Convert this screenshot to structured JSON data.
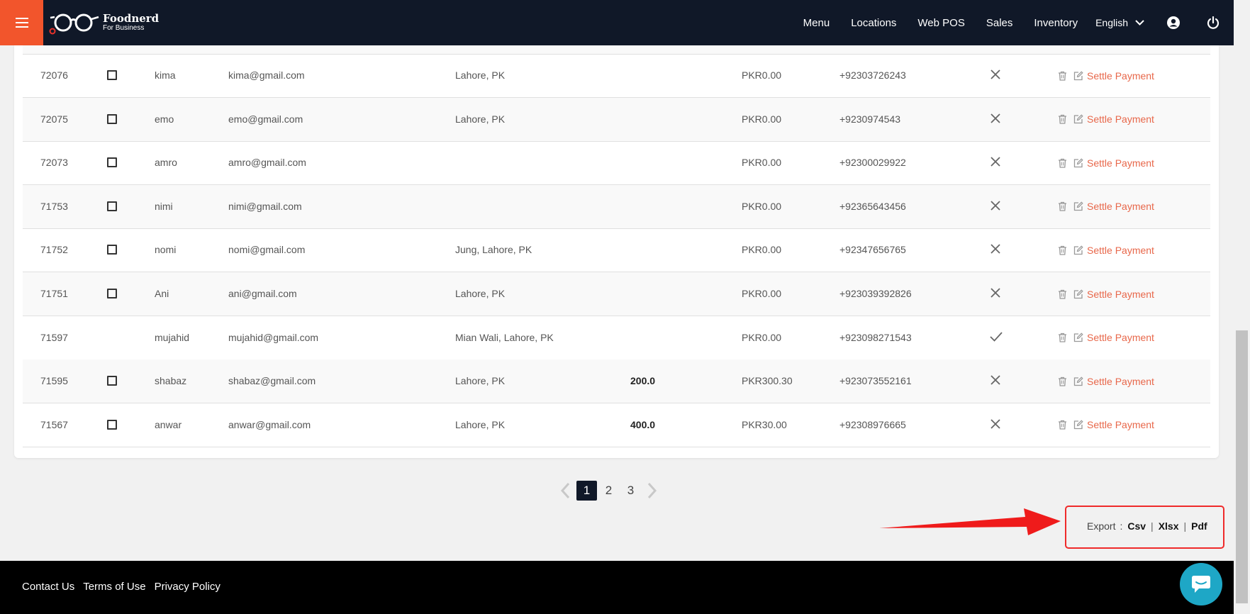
{
  "nav": {
    "brand_name": "Foodnerd",
    "brand_sub": "For Business",
    "links": [
      "Menu",
      "Locations",
      "Web POS",
      "Sales",
      "Inventory"
    ],
    "language": "English"
  },
  "rows": [
    {
      "id": "72076",
      "checkbox": true,
      "name": "kima",
      "email": "kima@gmail.com",
      "address": "Lahore, PK",
      "amount": "",
      "balance": "PKR0.00",
      "phone": "+92303726243",
      "status": "x",
      "action": "Settle Payment"
    },
    {
      "id": "72075",
      "checkbox": true,
      "name": "emo",
      "email": "emo@gmail.com",
      "address": "Lahore, PK",
      "amount": "",
      "balance": "PKR0.00",
      "phone": "+9230974543",
      "status": "x",
      "action": "Settle Payment"
    },
    {
      "id": "72073",
      "checkbox": true,
      "name": "amro",
      "email": "amro@gmail.com",
      "address": "",
      "amount": "",
      "balance": "PKR0.00",
      "phone": "+92300029922",
      "status": "x",
      "action": "Settle Payment"
    },
    {
      "id": "71753",
      "checkbox": true,
      "name": "nimi",
      "email": "nimi@gmail.com",
      "address": "",
      "amount": "",
      "balance": "PKR0.00",
      "phone": "+92365643456",
      "status": "x",
      "action": "Settle Payment"
    },
    {
      "id": "71752",
      "checkbox": true,
      "name": "nomi",
      "email": "nomi@gmail.com",
      "address": "Jung, Lahore, PK",
      "amount": "",
      "balance": "PKR0.00",
      "phone": "+92347656765",
      "status": "x",
      "action": "Settle Payment"
    },
    {
      "id": "71751",
      "checkbox": true,
      "name": "Ani",
      "email": "ani@gmail.com",
      "address": "Lahore, PK",
      "amount": "",
      "balance": "PKR0.00",
      "phone": "+923039392826",
      "status": "x",
      "action": "Settle Payment"
    },
    {
      "id": "71597",
      "checkbox": false,
      "name": "mujahid",
      "email": "mujahid@gmail.com",
      "address": "Mian Wali, Lahore, PK",
      "amount": "",
      "balance": "PKR0.00",
      "phone": "+923098271543",
      "status": "check",
      "action": "Settle Payment"
    },
    {
      "id": "71595",
      "checkbox": true,
      "name": "shabaz",
      "email": "shabaz@gmail.com",
      "address": "Lahore, PK",
      "amount": "200.0",
      "balance": "PKR300.30",
      "phone": "+923073552161",
      "status": "x",
      "action": "Settle Payment"
    },
    {
      "id": "71567",
      "checkbox": true,
      "name": "anwar",
      "email": "anwar@gmail.com",
      "address": "Lahore, PK",
      "amount": "400.0",
      "balance": "PKR30.00",
      "phone": "+92308976665",
      "status": "x",
      "action": "Settle Payment"
    }
  ],
  "pagination": {
    "pages": [
      "1",
      "2",
      "3"
    ],
    "current": "1"
  },
  "export": {
    "label": "Export",
    "colon": ":",
    "csv": "Csv",
    "xlsx": "Xlsx",
    "pdf": "Pdf",
    "separator": "|"
  },
  "footer": {
    "links": [
      "Contact Us",
      "Terms of Use",
      "Privacy Policy"
    ]
  },
  "colors": {
    "nav_bg": "#101828",
    "accent": "#f2552c",
    "settle": "#e8674a",
    "highlight": "#ef2a2a",
    "chat": "#1ea7c6"
  },
  "icons": {
    "menu": "hamburger-icon",
    "user": "user-circle-icon",
    "power": "power-icon",
    "delete": "trash-icon",
    "edit": "edit-icon",
    "chat": "chat-icon"
  }
}
